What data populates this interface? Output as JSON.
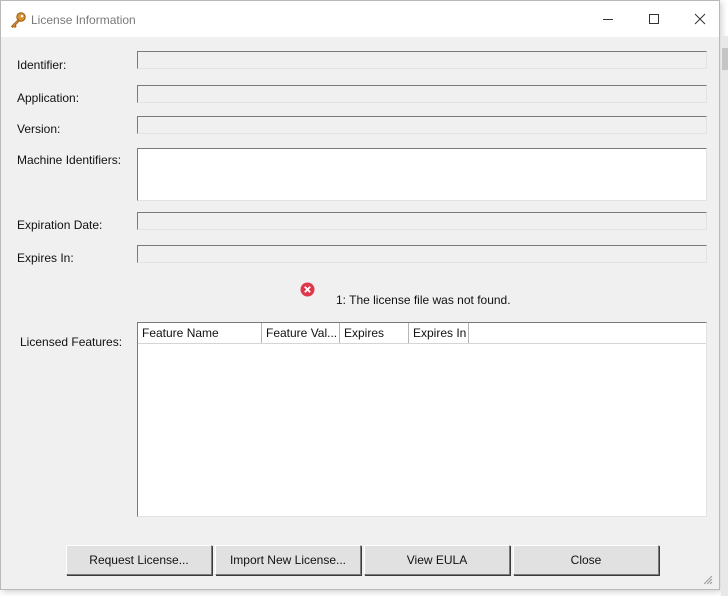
{
  "window": {
    "title": "License Information",
    "icon": "key-icon",
    "controls": {
      "minimize": "minimize-icon",
      "maximize": "maximize-icon",
      "close": "close-icon"
    }
  },
  "form": {
    "identifier_label": "Identifier:",
    "identifier_value": "",
    "application_label": "Application:",
    "application_value": "",
    "version_label": "Version:",
    "version_value": "",
    "machine_ids_label": "Machine Identifiers:",
    "machine_ids_value": "",
    "expiration_date_label": "Expiration Date:",
    "expiration_date_value": "",
    "expires_in_label": "Expires In:",
    "expires_in_value": ""
  },
  "message": {
    "icon": "error-icon",
    "text": "1: The license file was not found.",
    "color": "#e81123"
  },
  "features": {
    "label": "Licensed Features:",
    "columns": [
      "Feature Name",
      "Feature Val...",
      "Expires",
      "Expires In"
    ],
    "rows": []
  },
  "buttons": {
    "request": "Request License...",
    "import": "Import New License...",
    "eula": "View EULA",
    "close": "Close"
  }
}
